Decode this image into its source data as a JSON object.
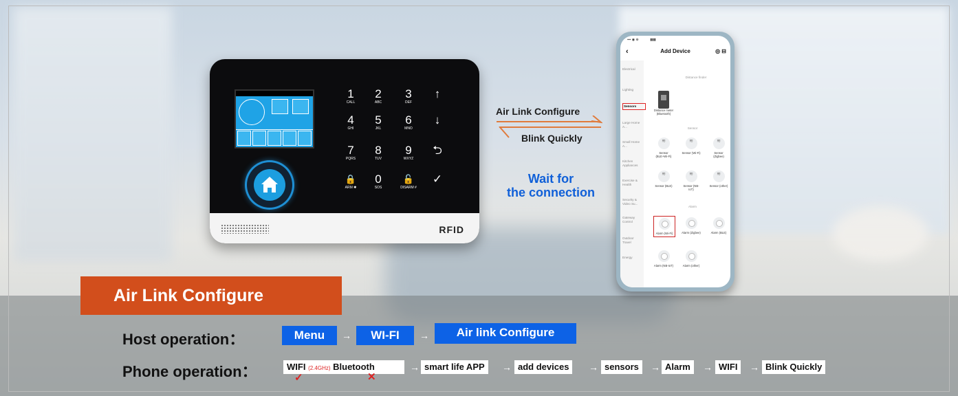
{
  "panel": {
    "brand": "RFID",
    "keys": [
      {
        "n": "1",
        "s": "CALL"
      },
      {
        "n": "2",
        "s": "ABC"
      },
      {
        "n": "3",
        "s": "DEF"
      },
      {
        "n": "↑",
        "s": ""
      },
      {
        "n": "4",
        "s": "GHI"
      },
      {
        "n": "5",
        "s": "JKL"
      },
      {
        "n": "6",
        "s": "MNO"
      },
      {
        "n": "↓",
        "s": ""
      },
      {
        "n": "7",
        "s": "PQRS"
      },
      {
        "n": "8",
        "s": "TUV"
      },
      {
        "n": "9",
        "s": "WXYZ"
      },
      {
        "n": "⮌",
        "s": ""
      },
      {
        "n": "🔒",
        "s": "ARM ✱"
      },
      {
        "n": "0",
        "s": "SOS"
      },
      {
        "n": "🔓",
        "s": "DISARM #"
      },
      {
        "n": "✓",
        "s": ""
      }
    ]
  },
  "flow": {
    "to_phone": "Air Link Configure",
    "to_panel": "Blink Quickly",
    "wait_line1": "Wait for",
    "wait_line2": "the connection"
  },
  "phone": {
    "title": "Add Device",
    "distance_label": "Distance finder",
    "sensor_label": "Sensor",
    "alarm_label": "Alarm",
    "categories": [
      "Electrical",
      "Lighting",
      "Sensors",
      "Large Home A...",
      "Small Home A...",
      "Kitchen Appliances",
      "Exercise & Health",
      "Security & Video Su...",
      "Gateway Control",
      "Outdoor Travel",
      "Energy"
    ],
    "distance_device": "Distance meter (Bluetooth)",
    "sensors": [
      "Sensor (BLE+Wi-Fi)",
      "Sensor (Wi-Fi)",
      "Sensor (Zigbee)",
      "Sensor (BLE)",
      "Sensor (NB-IoT)",
      "Sensor (other)"
    ],
    "alarms": [
      "Alarm (Wi-Fi)",
      "Alarm (Zigbee)",
      "Alarm (BLE)",
      "Alarm (NB-IoT)",
      "Alarm (other)"
    ]
  },
  "section_title": "Air Link Configure",
  "host": {
    "label": "Host operation：",
    "steps": [
      "Menu",
      "WI-FI",
      "Air link Configure"
    ]
  },
  "phone_op": {
    "label": "Phone operation：",
    "wifi": "WIFI",
    "band": "(2.4GHz)",
    "bluetooth": "Bluetooth",
    "steps": [
      "smart life APP",
      "add devices",
      "sensors",
      "Alarm",
      "WIFI",
      "Blink Quickly"
    ],
    "arrow": "→"
  }
}
